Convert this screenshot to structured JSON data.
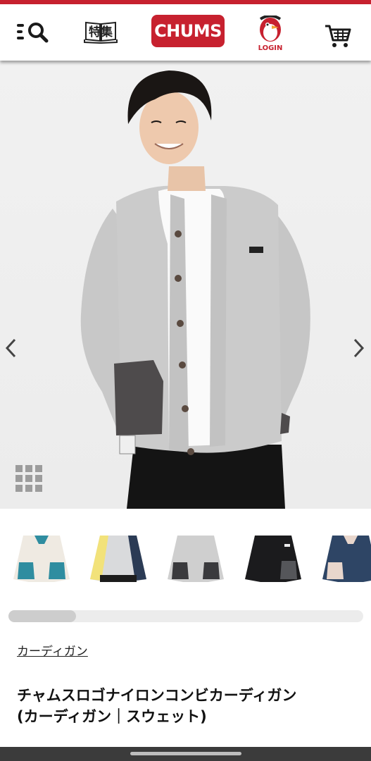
{
  "header": {
    "feature_label": "特集",
    "logo_text": "CHUMS",
    "login_label": "LOGIN",
    "brand_color": "#c7212f"
  },
  "product": {
    "category": "カーディガン",
    "title_line1": "チャムスロゴナイロンコンビカーディガン",
    "title_line2": "(カーディガン｜スウェット)"
  },
  "icons": {
    "menu_search": "menu-search-icon",
    "feature": "book-icon",
    "login": "penguin-icon",
    "cart": "cart-icon",
    "prev": "chevron-left-icon",
    "next": "chevron-right-icon",
    "grid": "grid-icon"
  },
  "thumbnails": [
    {
      "name": "off-white-teal",
      "body": "#efeae2",
      "accent": "#2f8da0"
    },
    {
      "name": "yellow-grey-navy",
      "body": "#d9dadc",
      "accent": "#2b3b55"
    },
    {
      "name": "heather-grey",
      "body": "#cfcfcf",
      "accent": "#3a3a3d"
    },
    {
      "name": "black",
      "body": "#1b1b1d",
      "accent": "#55565a"
    },
    {
      "name": "navy",
      "body": "#2e4565",
      "accent": "#e8d6cc"
    }
  ]
}
